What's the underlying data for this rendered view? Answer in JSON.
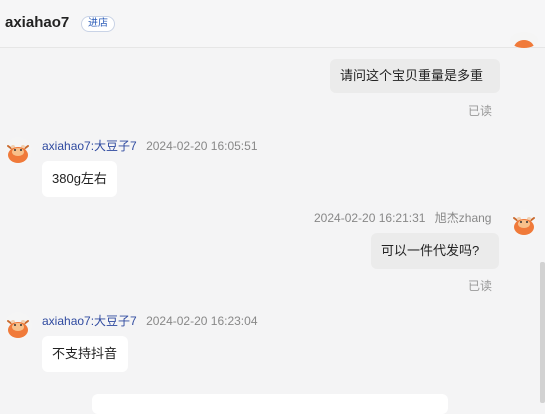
{
  "header": {
    "shop_name": "axiahao7",
    "enter_shop_label": "进店"
  },
  "messages": [
    {
      "side": "right",
      "text": "请问这个宝贝重量是多重",
      "read_label": "已读"
    },
    {
      "side": "left",
      "sender": "axiahao7:大豆子7",
      "timestamp": "2024-02-20 16:05:51",
      "text": "380g左右"
    },
    {
      "side": "right",
      "sender": "旭杰zhang",
      "timestamp": "2024-02-20 16:21:31",
      "text": "可以一件代发吗?",
      "read_label": "已读"
    },
    {
      "side": "left",
      "sender": "axiahao7:大豆子7",
      "timestamp": "2024-02-20 16:23:04",
      "text": "不支持抖音"
    }
  ],
  "colors": {
    "background": "#f4f4f5",
    "bubble_other": "#ffffff",
    "bubble_self": "#ebebeb",
    "sender_name": "#2f4aa0",
    "avatar_accent": "#f07a3a"
  },
  "icons": {
    "avatar": "cartoon-cow-avatar-icon"
  }
}
